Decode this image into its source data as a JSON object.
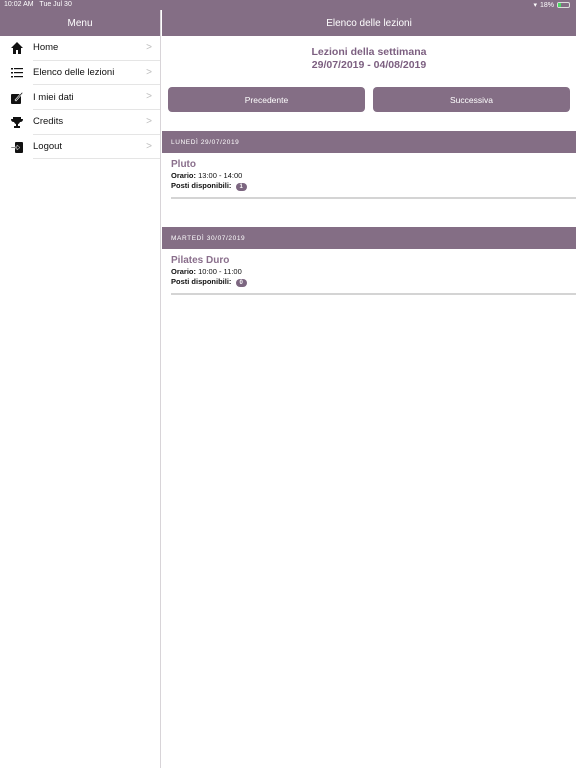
{
  "status_bar": {
    "time": "10:02 AM",
    "date": "Tue Jul 30",
    "battery": "18%"
  },
  "sidebar": {
    "title": "Menu",
    "items": [
      {
        "label": "Home",
        "icon": "home-icon"
      },
      {
        "label": "Elenco delle lezioni",
        "icon": "list-icon"
      },
      {
        "label": "I miei dati",
        "icon": "edit-icon"
      },
      {
        "label": "Credits",
        "icon": "trophy-icon"
      },
      {
        "label": "Logout",
        "icon": "logout-icon"
      }
    ]
  },
  "main": {
    "title": "Elenco delle lezioni",
    "week_label": "Lezioni della settimana",
    "week_range": "29/07/2019 - 04/08/2019",
    "prev_label": "Precedente",
    "next_label": "Successiva",
    "days": [
      {
        "header": "LUNEDÌ 29/07/2019",
        "lesson": {
          "name": "Pluto",
          "time_label": "Orario:",
          "time": "13:00 - 14:00",
          "seats_label": "Posti disponibili:",
          "seats": "1"
        }
      },
      {
        "header": "MARTEDÌ 30/07/2019",
        "lesson": {
          "name": "Pilates Duro",
          "time_label": "Orario:",
          "time": "10:00 - 11:00",
          "seats_label": "Posti disponibili:",
          "seats": "0"
        }
      }
    ]
  },
  "colors": {
    "accent": "#846e85",
    "title_text": "#7c5f80"
  }
}
